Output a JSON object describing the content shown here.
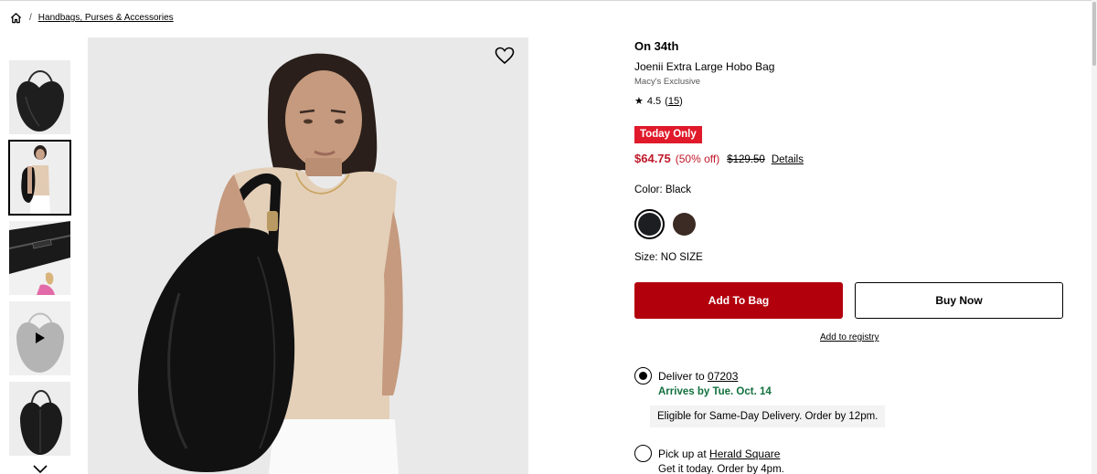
{
  "breadcrumb": {
    "home_icon": "home-icon",
    "separator": "/",
    "category": "Handbags, Purses & Accessories"
  },
  "gallery": {
    "thumbnails": [
      {
        "kind": "bag-front"
      },
      {
        "kind": "model",
        "selected": true
      },
      {
        "kind": "detail-zipper"
      },
      {
        "kind": "video"
      },
      {
        "kind": "bag-side"
      }
    ],
    "more_icon": "chevron-down-icon",
    "favorite_icon": "heart-icon"
  },
  "product": {
    "brand": "On 34th",
    "name": "Joenii Extra Large Hobo Bag",
    "exclusive": "Macy's Exclusive",
    "rating": "4.5",
    "review_count": "15",
    "badge": "Today Only",
    "sale_price": "$64.75",
    "discount": "(50% off)",
    "original_price": "$129.50",
    "details_link": "Details",
    "color_label": "Color: Black",
    "colors": [
      "#1c1e22",
      "#3b2b24"
    ],
    "size_label": "Size: NO SIZE"
  },
  "actions": {
    "add_to_bag": "Add To Bag",
    "buy_now": "Buy Now",
    "registry": "Add to registry",
    "accent": "#b3000d"
  },
  "fulfillment": {
    "deliver_prefix": "Deliver to",
    "zip": "07203",
    "arrives": "Arrives by Tue. Oct. 14",
    "same_day": "Eligible for Same-Day Delivery. Order by 12pm.",
    "pickup_prefix": "Pick up at",
    "store": "Herald Square",
    "pickup_time": "Get it today. Order by 4pm."
  }
}
